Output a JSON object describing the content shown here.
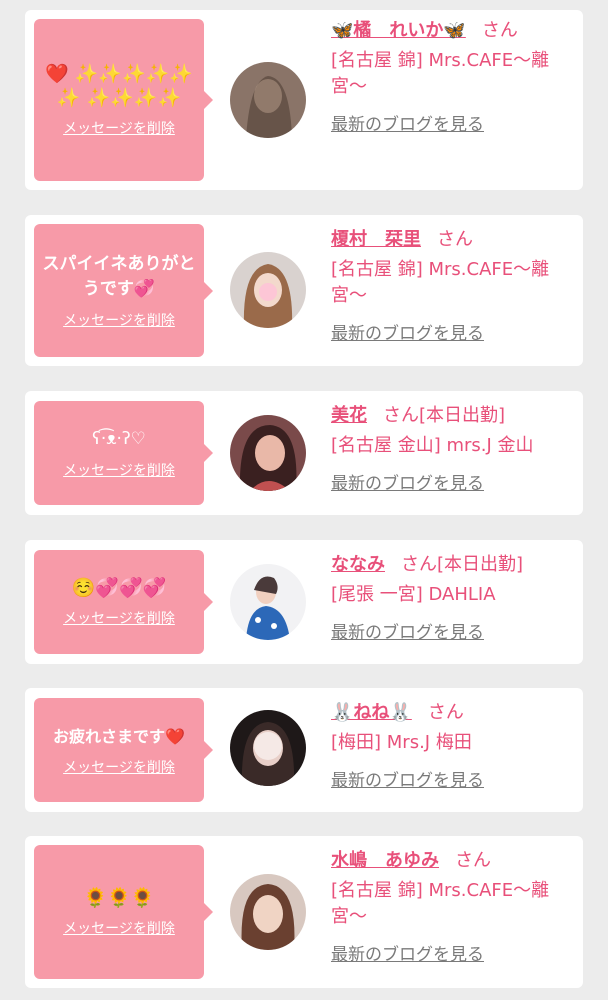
{
  "buttons": {
    "delete_label": "メッセージを削除",
    "blog_label": "最新のブログを見る",
    "san": "さん"
  },
  "cards": [
    {
      "message": "❤️ ✨✨✨✨✨✨ ✨✨✨✨",
      "name": "🦋橘　れいか🦋",
      "status": "",
      "shop": "[名古屋 錦] Mrs.CAFE〜離宮〜",
      "avatar_icon": "avatar-photo"
    },
    {
      "message": "スパイイネありがとうです💞",
      "name": "榎村　栞里",
      "status": "",
      "shop": "[名古屋 錦] Mrs.CAFE〜離宮〜",
      "avatar_icon": "avatar-photo"
    },
    {
      "message": "ʕ·͡ᴥ·ʔ♡",
      "name": "美花",
      "status": "[本日出勤]",
      "shop": "[名古屋 金山] mrs.J 金山",
      "avatar_icon": "avatar-photo"
    },
    {
      "message": "☺️💞💞💞",
      "name": "ななみ",
      "status": "[本日出勤]",
      "shop": "[尾張 一宮] DAHLIA",
      "avatar_icon": "avatar-photo"
    },
    {
      "message": "お疲れさまです❤️",
      "name": "🐰ねね🐰",
      "status": "",
      "shop": "[梅田] Mrs.J 梅田",
      "avatar_icon": "avatar-photo"
    },
    {
      "message": "🌻🌻🌻",
      "name": "水嶋　あゆみ",
      "status": "",
      "shop": "[名古屋 錦] Mrs.CAFE〜離宮〜",
      "avatar_icon": "avatar-photo"
    }
  ],
  "colors": {
    "bubble": "#f79aa8",
    "accent": "#e8507a",
    "link_gray": "#7a7a7a",
    "background": "#ececec"
  }
}
